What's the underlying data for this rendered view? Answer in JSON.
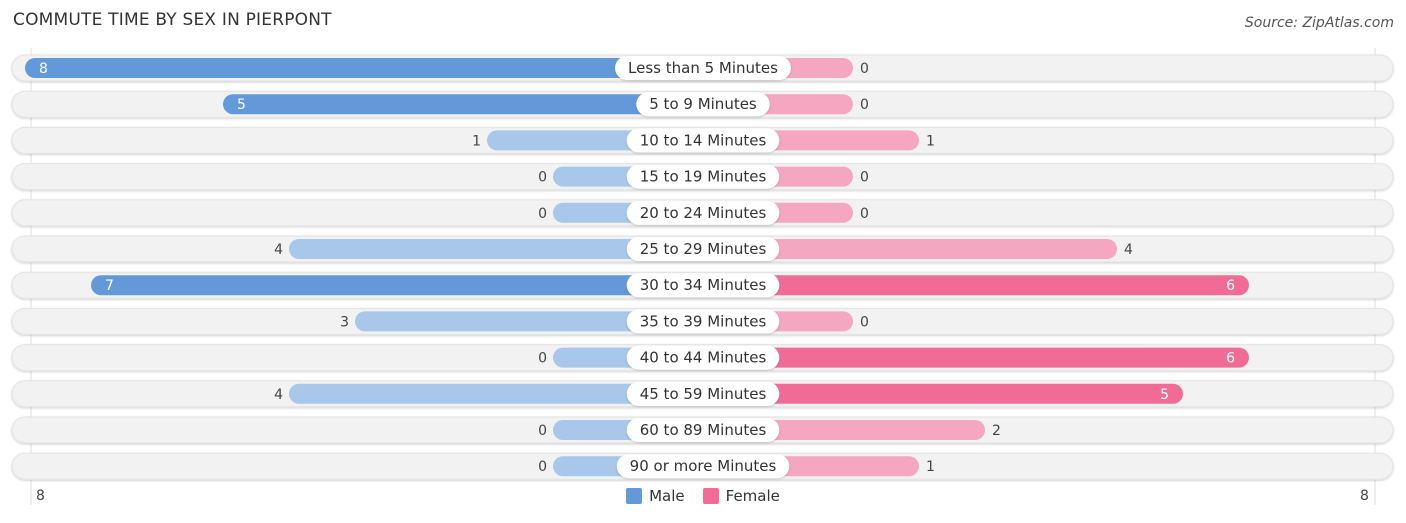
{
  "header": {
    "title": "COMMUTE TIME BY SEX IN PIERPONT",
    "source": "Source: ZipAtlas.com"
  },
  "colors": {
    "male_strong": "#6499d9",
    "male_light": "#a8c7ea",
    "female_strong": "#f06c97",
    "female_light": "#f5a6c0",
    "track": "#f2f2f2"
  },
  "chart_data": {
    "type": "bar",
    "orientation": "horizontal-diverging",
    "title": "COMMUTE TIME BY SEX IN PIERPONT",
    "categories": [
      "Less than 5 Minutes",
      "5 to 9 Minutes",
      "10 to 14 Minutes",
      "15 to 19 Minutes",
      "20 to 24 Minutes",
      "25 to 29 Minutes",
      "30 to 34 Minutes",
      "35 to 39 Minutes",
      "40 to 44 Minutes",
      "45 to 59 Minutes",
      "60 to 89 Minutes",
      "90 or more Minutes"
    ],
    "series": [
      {
        "name": "Male",
        "values": [
          8,
          5,
          1,
          0,
          0,
          4,
          7,
          3,
          0,
          4,
          0,
          0
        ]
      },
      {
        "name": "Female",
        "values": [
          0,
          0,
          1,
          0,
          0,
          4,
          6,
          0,
          6,
          5,
          2,
          1
        ]
      }
    ],
    "axis": {
      "left_label": "8",
      "right_label": "8",
      "max": 8
    },
    "legend": {
      "position": "bottom-center",
      "items": [
        "Male",
        "Female"
      ]
    }
  }
}
